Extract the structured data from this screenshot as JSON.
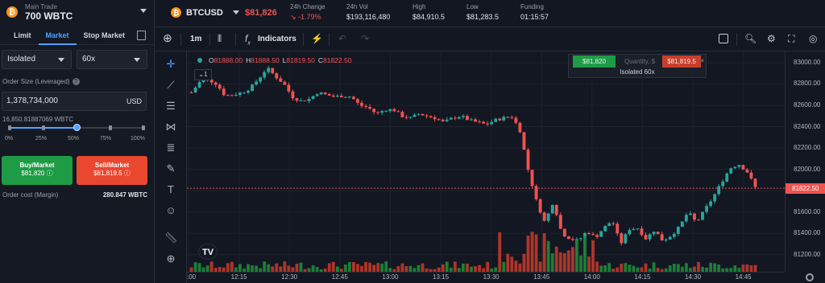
{
  "account": {
    "title": "Main Trade",
    "value": "700 WBTC",
    "coin_glyph": "₿"
  },
  "order_tabs": [
    {
      "label": "Limit",
      "active": false
    },
    {
      "label": "Market",
      "active": true
    },
    {
      "label": "Stop Market",
      "active": false
    }
  ],
  "margin_mode": "Isolated",
  "leverage": "60x",
  "order_size": {
    "label": "Order Size (Leveraged)",
    "value": "1,378,734,000",
    "unit": "USD",
    "sub": "16,850.81887069  WBTC"
  },
  "slider": {
    "value_percent": 50,
    "marks": [
      "0%",
      "25%",
      "50%",
      "75%",
      "100%"
    ]
  },
  "buy": {
    "label": "Buy/Market",
    "price": "$81,820"
  },
  "sell": {
    "label": "Sell/Market",
    "price": "$81,819.5"
  },
  "order_cost": {
    "label": "Order cost (Margin)",
    "value": "280.847 WBTC"
  },
  "header": {
    "symbol": "BTCUSD",
    "last_price": "$81,826",
    "stats": [
      {
        "label": "24h Change",
        "value": "-1.79%",
        "negative": true
      },
      {
        "label": "24h Vol",
        "value": "$193,116,480"
      },
      {
        "label": "High",
        "value": "$84,910.5"
      },
      {
        "label": "Low",
        "value": "$81,283.5"
      },
      {
        "label": "Funding",
        "value": "01:15:57"
      }
    ]
  },
  "toolbar": {
    "interval": "1m",
    "indicators": "Indicators"
  },
  "ohlc": {
    "o": "81888.00",
    "h": "81888.50",
    "l": "81819.50",
    "c": "81822.50",
    "o_label": "O",
    "h_label": "H",
    "l_label": "L",
    "c_label": "C"
  },
  "collapse_label": "1",
  "quick_trade": {
    "buy": "$81,820",
    "qty_placeholder": "Quantity, $",
    "sell": "$81,819.5",
    "mode": "Isolated 60x"
  },
  "tv_logo": "TV",
  "price_tag": "81822.50",
  "colors": {
    "up": "#26a69a",
    "down": "#ef5350",
    "accent": "#4da3ff",
    "buy_btn": "#1e9b45",
    "sell_btn": "#e9472f"
  },
  "chart_data": {
    "type": "candlestick",
    "y_ticks": [
      "83000.00",
      "82800.00",
      "82600.00",
      "82400.00",
      "82200.00",
      "82000.00",
      "81800.00",
      "81600.00",
      "81400.00",
      "81200.00"
    ],
    "x_ticks": [
      ":00",
      "12:15",
      "12:30",
      "12:45",
      "13:00",
      "13:15",
      "13:30",
      "13:45",
      "14:00",
      "14:15",
      "14:30",
      "14:45"
    ],
    "ylim": [
      81130,
      83060
    ],
    "close_path": [
      82720,
      82820,
      82840,
      82800,
      82690,
      82700,
      82720,
      82760,
      82850,
      82950,
      82870,
      82800,
      82680,
      82640,
      82660,
      82720,
      82700,
      82680,
      82690,
      82680,
      82600,
      82580,
      82520,
      82560,
      82560,
      82500,
      82480,
      82520,
      82500,
      82480,
      82440,
      82480,
      82500,
      82460,
      82440,
      82420,
      82460,
      82480,
      82500,
      82380,
      82000,
      81700,
      81500,
      81700,
      81400,
      81350,
      81330,
      81420,
      81360,
      81450,
      81520,
      81300,
      81440,
      81450,
      81350,
      81430,
      81330,
      81380,
      81460,
      81600,
      81500,
      81620,
      81740,
      81880,
      82010,
      82050,
      81980,
      81830
    ],
    "last": 81822.5
  }
}
